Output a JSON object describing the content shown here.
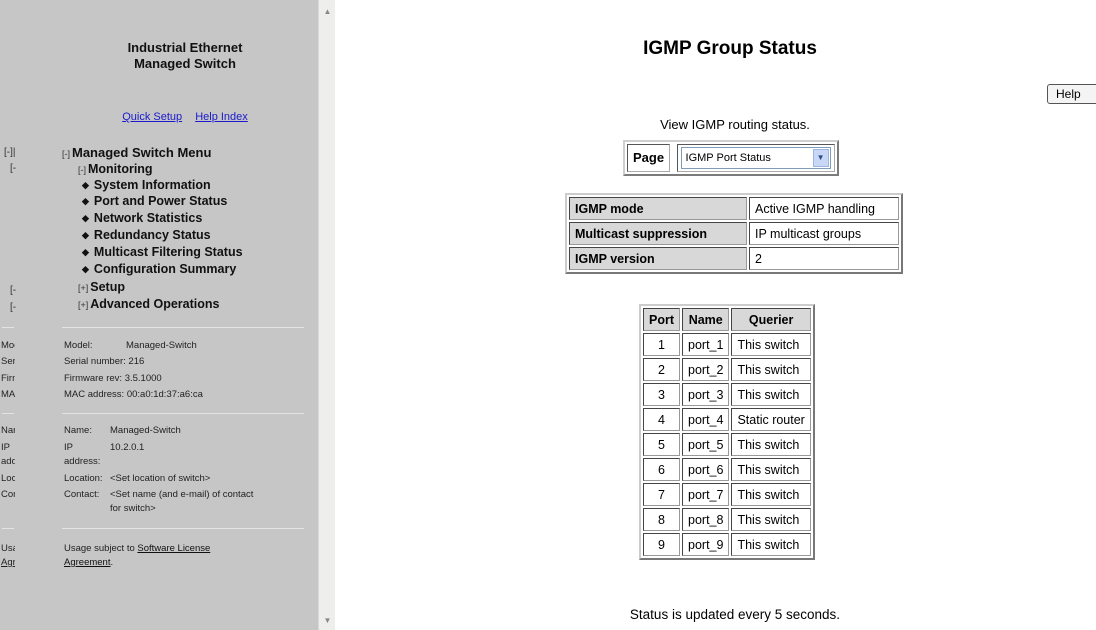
{
  "sidebar": {
    "brand_line1": "Industrial Ethernet",
    "brand_line2": "Managed Switch",
    "links": {
      "quick_setup": "Quick Setup",
      "help_index": "Help Index"
    },
    "ghost_col": [
      "[-]|",
      "[-",
      "[-",
      "[-"
    ],
    "menu": {
      "root": {
        "toggle": "[-]",
        "label": "Managed Switch Menu"
      },
      "monitoring": {
        "toggle": "[-]",
        "label": "Monitoring"
      },
      "monitoring_items": [
        "System Information",
        "Port and Power Status",
        "Network Statistics",
        "Redundancy Status",
        "Multicast Filtering Status",
        "Configuration Summary"
      ],
      "setup": {
        "toggle": "[+]",
        "label": "Setup"
      },
      "advanced": {
        "toggle": "[+]",
        "label": "Advanced Operations"
      }
    },
    "left_fragments": [
      "Mod",
      "Seri",
      "Firm",
      "MAC",
      "Nam",
      "IP",
      "addr",
      "Loca",
      "Cont",
      "Usa",
      "Agr"
    ],
    "device": {
      "model_label": "Model:",
      "model_value": "Managed-Switch",
      "serial": "Serial number: 216",
      "firmware": "Firmware rev: 3.5.1000",
      "mac": "MAC address: 00:a0:1d:37:a6:ca",
      "name_label": "Name:",
      "name_value": "Managed-Switch",
      "ip_label_1": "IP",
      "ip_label_2": "address:",
      "ip_value": "10.2.0.1",
      "location_label": "Location:",
      "location_value": "<Set location of switch>",
      "contact_label": "Contact:",
      "contact_value_1": "<Set name (and e-mail) of contact",
      "contact_value_2": "for switch>",
      "usage_prefix": "Usage subject to ",
      "usage_link_1": "Software License",
      "usage_link_2": "Agreement",
      "usage_suffix": "."
    }
  },
  "main": {
    "title": "IGMP Group Status",
    "help_button": "Help",
    "subtitle": "View IGMP routing status.",
    "page_label": "Page",
    "page_select_value": "IGMP Port Status",
    "mode_rows": [
      {
        "label": "IGMP mode",
        "value": "Active IGMP handling"
      },
      {
        "label": "Multicast suppression",
        "value": "IP multicast groups"
      },
      {
        "label": "IGMP version",
        "value": "2"
      }
    ],
    "port_headers": {
      "port": "Port",
      "name": "Name",
      "querier": "Querier"
    },
    "ports": [
      {
        "port": "1",
        "name": "port_1",
        "querier": "This switch"
      },
      {
        "port": "2",
        "name": "port_2",
        "querier": "This switch"
      },
      {
        "port": "3",
        "name": "port_3",
        "querier": "This switch"
      },
      {
        "port": "4",
        "name": "port_4",
        "querier": "Static router"
      },
      {
        "port": "5",
        "name": "port_5",
        "querier": "This switch"
      },
      {
        "port": "6",
        "name": "port_6",
        "querier": "This switch"
      },
      {
        "port": "7",
        "name": "port_7",
        "querier": "This switch"
      },
      {
        "port": "8",
        "name": "port_8",
        "querier": "This switch"
      },
      {
        "port": "9",
        "name": "port_9",
        "querier": "This switch"
      }
    ],
    "footer": "Status is updated every 5 seconds."
  },
  "icons": {
    "bullet": "diamond-bullet-icon",
    "scroll_up": "scroll-up-arrow-icon",
    "scroll_down": "scroll-down-arrow-icon",
    "dropdown": "chevron-down-icon"
  }
}
